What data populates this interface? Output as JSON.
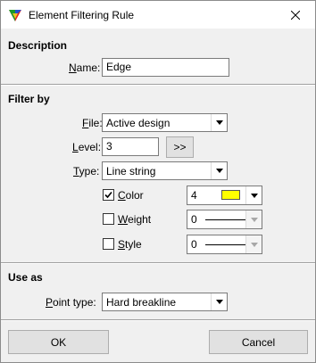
{
  "window": {
    "title": "Element Filtering Rule"
  },
  "description": {
    "heading": "Description",
    "name_label": "Name:",
    "name_value": "Edge"
  },
  "filter": {
    "heading": "Filter by",
    "file_label": "File:",
    "file_value": "Active design",
    "level_label": "Level:",
    "level_value": "3",
    "level_button": ">>",
    "type_label": "Type:",
    "type_value": "Line string",
    "color": {
      "label": "Color",
      "checked": true,
      "value": "4",
      "swatch": "#ffff00"
    },
    "weight": {
      "label": "Weight",
      "checked": false,
      "value": "0"
    },
    "style": {
      "label": "Style",
      "checked": false,
      "value": "0"
    }
  },
  "use_as": {
    "heading": "Use as",
    "point_type_label": "Point type:",
    "point_type_value": "Hard breakline"
  },
  "buttons": {
    "ok": "OK",
    "cancel": "Cancel"
  },
  "icons": {
    "app": "microstation-triangle-icon",
    "close": "close-icon",
    "dropdown": "chevron-down-icon",
    "check": "checkmark-icon"
  }
}
